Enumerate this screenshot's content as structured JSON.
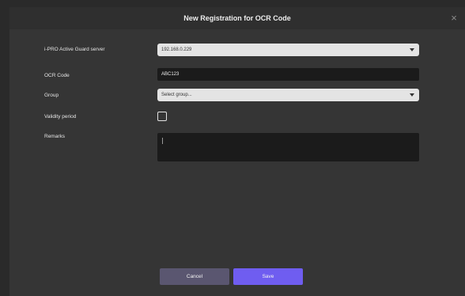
{
  "dialog": {
    "title": "New Registration for OCR Code",
    "close_glyph": "×"
  },
  "form": {
    "server": {
      "label": "i-PRO Active Guard server",
      "value": "192.168.0.229"
    },
    "ocr_code": {
      "label": "OCR Code",
      "value": "ABC123"
    },
    "group": {
      "label": "Group",
      "placeholder": "Select group..."
    },
    "validity": {
      "label": "Validity period",
      "checked": false
    },
    "remarks": {
      "label": "Remarks",
      "value": ""
    }
  },
  "buttons": {
    "cancel_label": "Cancel",
    "save_label": "Save"
  },
  "colors": {
    "primary_button": "#6f5df0",
    "secondary_button": "#5a5670"
  },
  "icons": {
    "close": "close-icon",
    "dropdown": "chevron-down-icon"
  }
}
